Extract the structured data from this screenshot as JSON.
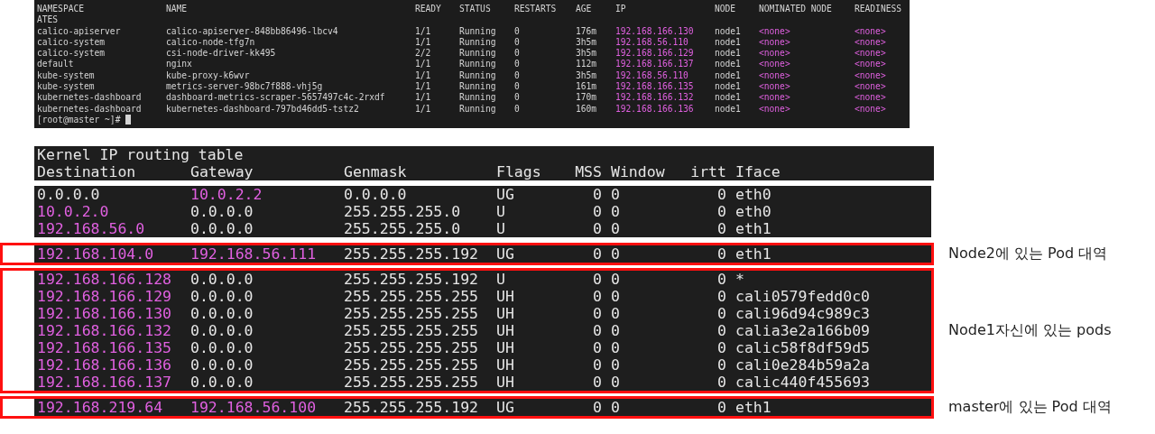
{
  "pods_terminal": {
    "columns": [
      "NAMESPACE",
      "NAME",
      "READY",
      "STATUS",
      "RESTARTS",
      "AGE",
      "IP",
      "NODE",
      "NOMINATED NODE",
      "READINESS"
    ],
    "header_wrap": "ATES",
    "rows": [
      {
        "namespace": "calico-apiserver",
        "name": "calico-apiserver-848bb86496-lbcv4",
        "ready": "1/1",
        "status": "Running",
        "restarts": "0",
        "age": "176m",
        "ip": "192.168.166.130",
        "node": "node1",
        "nominated_node": "<none>",
        "readiness": "<none>"
      },
      {
        "namespace": "calico-system",
        "name": "calico-node-tfg7n",
        "ready": "1/1",
        "status": "Running",
        "restarts": "0",
        "age": "3h5m",
        "ip": "192.168.56.110",
        "node": "node1",
        "nominated_node": "<none>",
        "readiness": "<none>"
      },
      {
        "namespace": "calico-system",
        "name": "csi-node-driver-kk495",
        "ready": "2/2",
        "status": "Running",
        "restarts": "0",
        "age": "3h5m",
        "ip": "192.168.166.129",
        "node": "node1",
        "nominated_node": "<none>",
        "readiness": "<none>"
      },
      {
        "namespace": "default",
        "name": "nginx",
        "ready": "1/1",
        "status": "Running",
        "restarts": "0",
        "age": "112m",
        "ip": "192.168.166.137",
        "node": "node1",
        "nominated_node": "<none>",
        "readiness": "<none>"
      },
      {
        "namespace": "kube-system",
        "name": "kube-proxy-k6wvr",
        "ready": "1/1",
        "status": "Running",
        "restarts": "0",
        "age": "3h5m",
        "ip": "192.168.56.110",
        "node": "node1",
        "nominated_node": "<none>",
        "readiness": "<none>"
      },
      {
        "namespace": "kube-system",
        "name": "metrics-server-98bc7f888-vhj5g",
        "ready": "1/1",
        "status": "Running",
        "restarts": "0",
        "age": "161m",
        "ip": "192.168.166.135",
        "node": "node1",
        "nominated_node": "<none>",
        "readiness": "<none>"
      },
      {
        "namespace": "kubernetes-dashboard",
        "name": "dashboard-metrics-scraper-5657497c4c-2rxdf",
        "ready": "1/1",
        "status": "Running",
        "restarts": "0",
        "age": "170m",
        "ip": "192.168.166.132",
        "node": "node1",
        "nominated_node": "<none>",
        "readiness": "<none>"
      },
      {
        "namespace": "kubernetes-dashboard",
        "name": "kubernetes-dashboard-797bd46dd5-tstz2",
        "ready": "1/1",
        "status": "Running",
        "restarts": "0",
        "age": "160m",
        "ip": "192.168.166.136",
        "node": "node1",
        "nominated_node": "<none>",
        "readiness": "<none>"
      }
    ],
    "prompt": "[root@master ~]#"
  },
  "routing_terminal": {
    "title": "Kernel IP routing table",
    "columns": [
      "Destination",
      "Gateway",
      "Genmask",
      "Flags",
      "MSS",
      "Window",
      "irtt",
      "Iface"
    ],
    "groups": [
      {
        "highlighted": false,
        "rows": [
          {
            "destination": "0.0.0.0",
            "gateway": "10.0.2.2",
            "genmask": "0.0.0.0",
            "flags": "UG",
            "mss": "0",
            "window": "0",
            "irtt": "0",
            "iface": "eth0",
            "destination_colored": false,
            "gateway_colored": true
          },
          {
            "destination": "10.0.2.0",
            "gateway": "0.0.0.0",
            "genmask": "255.255.255.0",
            "flags": "U",
            "mss": "0",
            "window": "0",
            "irtt": "0",
            "iface": "eth0",
            "destination_colored": true,
            "gateway_colored": false
          },
          {
            "destination": "192.168.56.0",
            "gateway": "0.0.0.0",
            "genmask": "255.255.255.0",
            "flags": "U",
            "mss": "0",
            "window": "0",
            "irtt": "0",
            "iface": "eth1",
            "destination_colored": true,
            "gateway_colored": false
          }
        ]
      },
      {
        "highlighted": true,
        "annotation": "Node2에 있는 Pod 대역",
        "rows": [
          {
            "destination": "192.168.104.0",
            "gateway": "192.168.56.111",
            "genmask": "255.255.255.192",
            "flags": "UG",
            "mss": "0",
            "window": "0",
            "irtt": "0",
            "iface": "eth1",
            "destination_colored": true,
            "gateway_colored": true
          }
        ]
      },
      {
        "highlighted": true,
        "annotation": "Node1자신에 있는 pods",
        "rows": [
          {
            "destination": "192.168.166.128",
            "gateway": "0.0.0.0",
            "genmask": "255.255.255.192",
            "flags": "U",
            "mss": "0",
            "window": "0",
            "irtt": "0",
            "iface": "*",
            "destination_colored": true,
            "gateway_colored": false
          },
          {
            "destination": "192.168.166.129",
            "gateway": "0.0.0.0",
            "genmask": "255.255.255.255",
            "flags": "UH",
            "mss": "0",
            "window": "0",
            "irtt": "0",
            "iface": "cali0579fedd0c0",
            "destination_colored": true,
            "gateway_colored": false
          },
          {
            "destination": "192.168.166.130",
            "gateway": "0.0.0.0",
            "genmask": "255.255.255.255",
            "flags": "UH",
            "mss": "0",
            "window": "0",
            "irtt": "0",
            "iface": "cali96d94c989c3",
            "destination_colored": true,
            "gateway_colored": false
          },
          {
            "destination": "192.168.166.132",
            "gateway": "0.0.0.0",
            "genmask": "255.255.255.255",
            "flags": "UH",
            "mss": "0",
            "window": "0",
            "irtt": "0",
            "iface": "calia3e2a166b09",
            "destination_colored": true,
            "gateway_colored": false
          },
          {
            "destination": "192.168.166.135",
            "gateway": "0.0.0.0",
            "genmask": "255.255.255.255",
            "flags": "UH",
            "mss": "0",
            "window": "0",
            "irtt": "0",
            "iface": "calic58f8df59d5",
            "destination_colored": true,
            "gateway_colored": false
          },
          {
            "destination": "192.168.166.136",
            "gateway": "0.0.0.0",
            "genmask": "255.255.255.255",
            "flags": "UH",
            "mss": "0",
            "window": "0",
            "irtt": "0",
            "iface": "cali0e284b59a2a",
            "destination_colored": true,
            "gateway_colored": false
          },
          {
            "destination": "192.168.166.137",
            "gateway": "0.0.0.0",
            "genmask": "255.255.255.255",
            "flags": "UH",
            "mss": "0",
            "window": "0",
            "irtt": "0",
            "iface": "calic440f455693",
            "destination_colored": true,
            "gateway_colored": false
          }
        ]
      },
      {
        "highlighted": true,
        "annotation": "master에 있는 Pod 대역",
        "rows": [
          {
            "destination": "192.168.219.64",
            "gateway": "192.168.56.100",
            "genmask": "255.255.255.192",
            "flags": "UG",
            "mss": "0",
            "window": "0",
            "irtt": "0",
            "iface": "eth1",
            "destination_colored": true,
            "gateway_colored": true
          }
        ]
      }
    ]
  }
}
